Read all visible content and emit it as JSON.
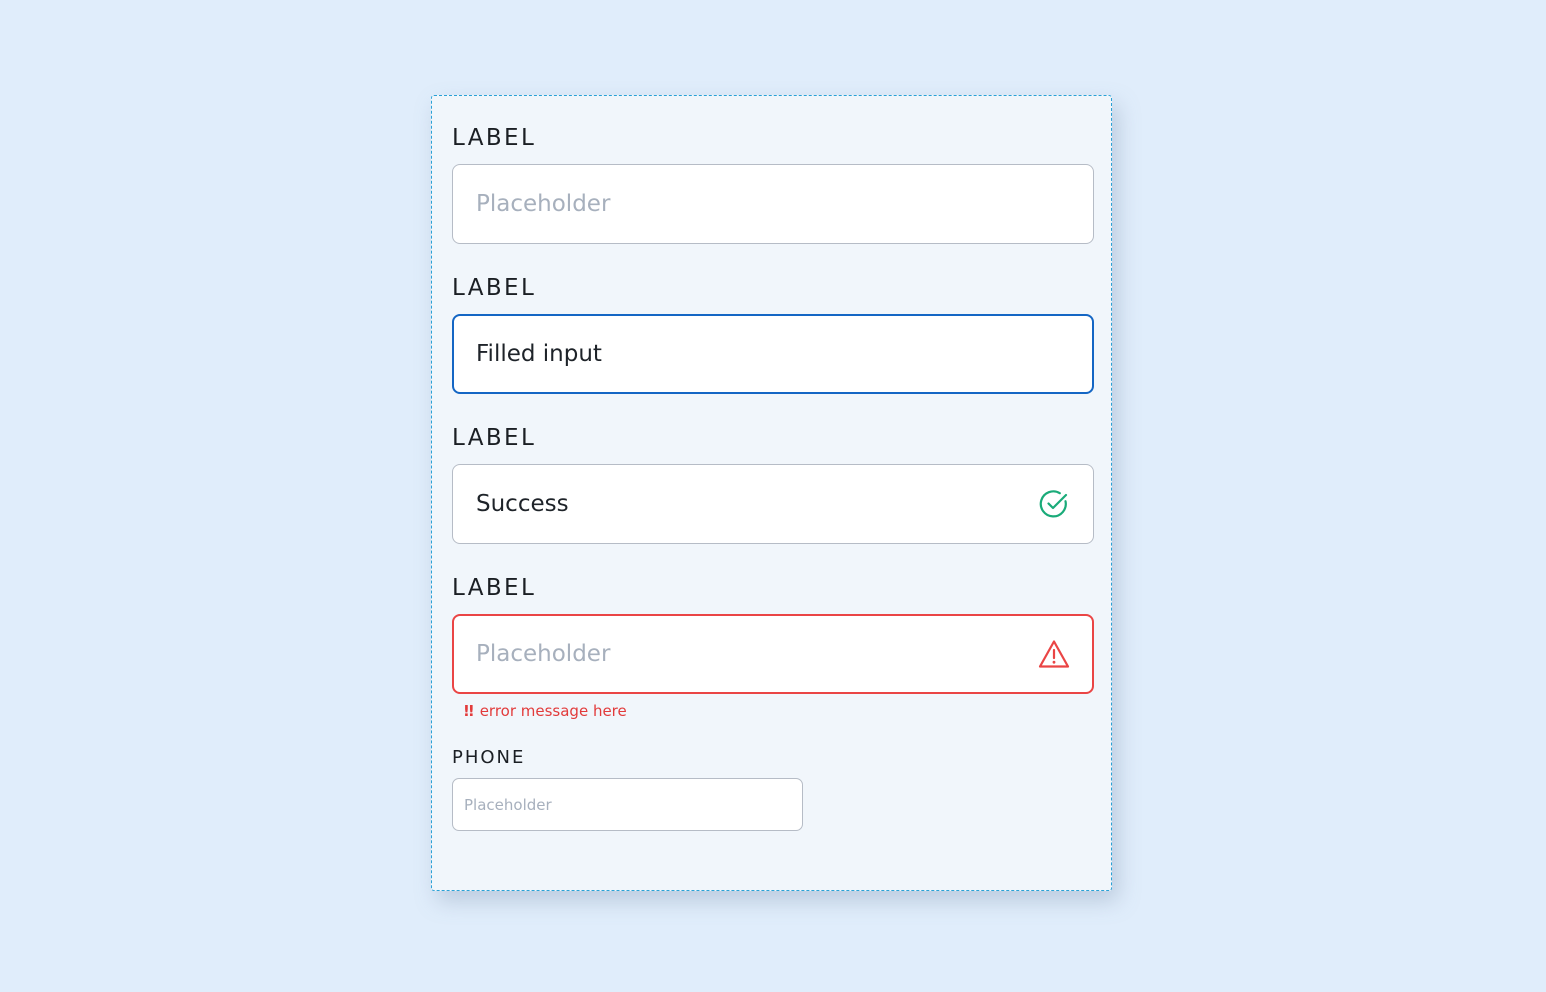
{
  "form": {
    "fields": [
      {
        "label": "LABEL",
        "placeholder": "Placeholder",
        "value": "",
        "state": "default"
      },
      {
        "label": "LABEL",
        "placeholder": "",
        "value": "Filled input",
        "state": "focused"
      },
      {
        "label": "LABEL",
        "placeholder": "",
        "value": "Success",
        "state": "success",
        "icon": "check-circle-icon"
      },
      {
        "label": "LABEL",
        "placeholder": "Placeholder",
        "value": "",
        "state": "error",
        "icon": "warning-triangle-icon",
        "error_message": "error message here",
        "error_prefix": "!!"
      }
    ],
    "phone": {
      "label": "PHONE",
      "placeholder": "Placeholder"
    }
  },
  "colors": {
    "background": "#e0edfb",
    "panel": "#f1f6fb",
    "focus": "#1466c4",
    "success": "#1aab79",
    "error": "#ea4545",
    "placeholder": "#a7b0bd"
  }
}
